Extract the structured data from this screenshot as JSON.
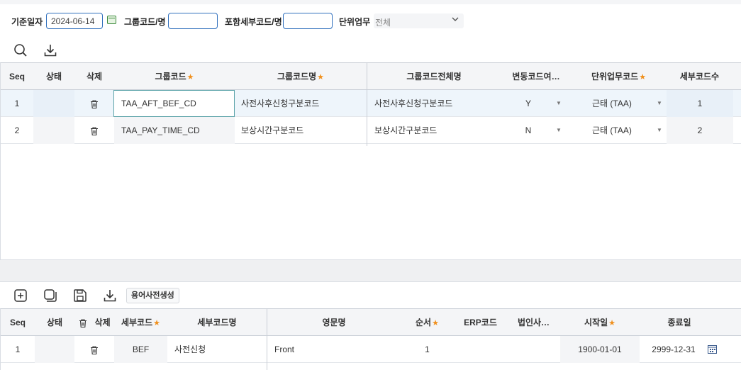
{
  "search": {
    "base_date_label": "기준일자",
    "base_date_value": "2024-06-14",
    "group_code_label": "그룹코드/명",
    "group_code_value": "",
    "detail_code_label": "포함세부코드/명",
    "detail_code_value": "",
    "unit_work_label": "단위업무",
    "unit_work_value": "전체"
  },
  "top_grid": {
    "headers": {
      "seq": "Seq",
      "status": "상태",
      "delete": "삭제",
      "group_code": "그룹코드",
      "group_code_name": "그룹코드명",
      "group_code_full": "그룹코드전체명",
      "variable": "변동코드여…",
      "unit_work_code": "단위업무코드",
      "detail_count": "세부코드수"
    },
    "rows": [
      {
        "seq": "1",
        "group_code": "TAA_AFT_BEF_CD",
        "group_code_name": "사전사후신청구분코드",
        "group_code_full": "사전사후신청구분코드",
        "variable": "Y",
        "unit_work_code": "근태 (TAA)",
        "detail_count": "1"
      },
      {
        "seq": "2",
        "group_code": "TAA_PAY_TIME_CD",
        "group_code_name": "보상시간구분코드",
        "group_code_full": "보상시간구분코드",
        "variable": "N",
        "unit_work_code": "근태 (TAA)",
        "detail_count": "2"
      }
    ]
  },
  "bottom_toolbar": {
    "dictionary_button": "용어사전생성"
  },
  "bottom_grid": {
    "headers": {
      "seq": "Seq",
      "status": "상태",
      "delete": "삭제",
      "detail_code": "세부코드",
      "detail_code_name": "세부코드명",
      "english_name": "영문명",
      "order": "순서",
      "erp_code": "ERP코드",
      "corp_use": "법인사…",
      "start_date": "시작일",
      "end_date": "종료일"
    },
    "rows": [
      {
        "seq": "1",
        "detail_code": "BEF",
        "detail_code_name": "사전신청",
        "english_name": "Front",
        "order": "1",
        "erp_code": "",
        "corp_use": "",
        "start_date": "1900-01-01",
        "end_date": "2999-12-31"
      }
    ]
  },
  "colors": {
    "accent": "#2f6fbd",
    "required_star": "#f0901d",
    "header_bg": "#f4f5f7",
    "selected_row": "#eef5fb"
  }
}
